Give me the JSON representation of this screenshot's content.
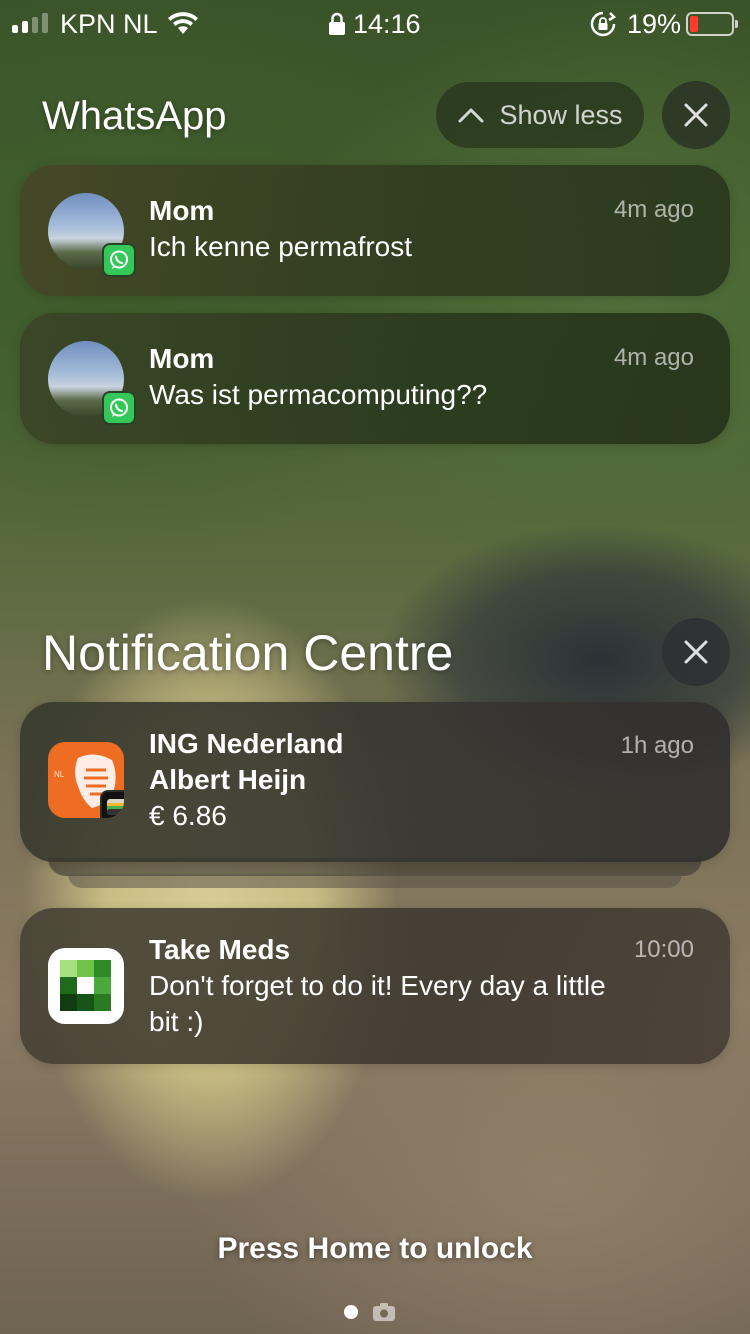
{
  "status_bar": {
    "carrier": "KPN NL",
    "time": "14:16",
    "battery_percent": "19%",
    "battery_level": 0.19,
    "battery_color": "#ff3b30",
    "icons": [
      "signal-icon",
      "wifi-icon",
      "lock-icon",
      "rotation-lock-icon",
      "battery-icon"
    ]
  },
  "whatsapp_group": {
    "title": "WhatsApp",
    "show_less_label": "Show less",
    "notifications": [
      {
        "sender": "Mom",
        "message": "Ich kenne permafrost",
        "time": "4m ago"
      },
      {
        "sender": "Mom",
        "message": "Was ist permacomputing??",
        "time": "4m ago"
      }
    ]
  },
  "notification_centre": {
    "title": "Notification Centre",
    "notifications": [
      {
        "app": "ING Nederland",
        "title": "Albert Heijn",
        "body": "€ 6.86",
        "time": "1h ago",
        "icon_brand_color": "#ef6d22",
        "icon_text": "NL"
      },
      {
        "app": "Take Meds",
        "body": "Don't forget to do it! Every day a little bit :)",
        "time": "10:00"
      }
    ]
  },
  "lock_screen": {
    "unlock_hint": "Press Home to unlock"
  }
}
